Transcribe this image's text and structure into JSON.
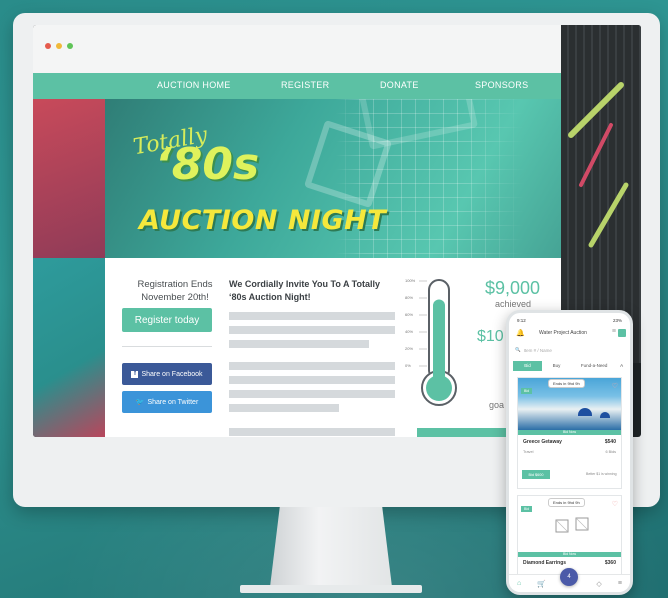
{
  "colors": {
    "accent": "#5cc1a4",
    "facebook": "#3b5998",
    "twitter": "#3b94d9",
    "background": "#2f9794"
  },
  "nav": {
    "items": [
      "AUCTION HOME",
      "REGISTER",
      "DONATE",
      "SPONSORS"
    ]
  },
  "hero": {
    "line1": "Totally",
    "line2": "‘80s",
    "line3": "AUCTION NIGHT"
  },
  "registration": {
    "text": "Registration Ends November 20th!",
    "button_label": "Register today"
  },
  "social": {
    "facebook_label": "Share on Facebook",
    "twitter_label": "Share on Twitter"
  },
  "invite": {
    "heading": "We Cordially Invite You To A Totally ‘80s Auction Night!"
  },
  "thermometer": {
    "ticks": [
      "100%",
      "80%",
      "60%",
      "40%",
      "20%",
      "0%"
    ],
    "fill_fraction": 0.9
  },
  "fundraising": {
    "achieved_amount": "$9,000",
    "achieved_label": "achieved",
    "goal_amount_partial": "$10",
    "goal_label_partial": "goa"
  },
  "phone": {
    "status_time": "9:12",
    "status_right": "23%",
    "app_title": "Water Project Auction",
    "search_placeholder": "Item # / Name",
    "tabs": [
      "Bid",
      "Buy",
      "Fund-a-Need"
    ],
    "tabs_overflow": "A",
    "fab_count": "4",
    "items": [
      {
        "pill": "Ends in 9hd 9h",
        "tag": "Bid",
        "strip": "Bid Now",
        "name": "Greece Getaway",
        "price": "$540",
        "category": "Travel",
        "bids": "6 Bids",
        "bid_button": "Bid $600",
        "bid_note": "Better $1 is winning"
      },
      {
        "pill": "Ends in 9hd 9h",
        "tag": "Bid",
        "strip": "Bid Now",
        "name": "Diamond Earrings",
        "price": "$360"
      }
    ]
  }
}
